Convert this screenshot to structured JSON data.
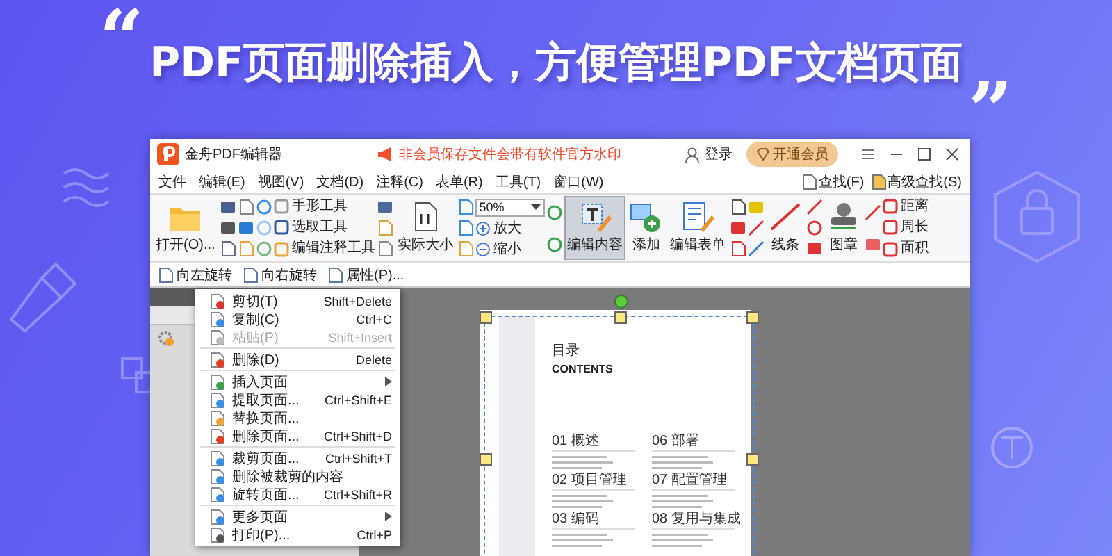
{
  "headline": {
    "open_quote": "“",
    "text": "PDF页面删除插入，方便管理PDF文档页面",
    "close_quote": "”"
  },
  "app": {
    "title": "金舟PDF编辑器",
    "notice": "非会员保存文件会带有软件官方水印",
    "login": "登录",
    "vip_button": "开通会员",
    "menu": [
      "文件",
      "编辑(E)",
      "视图(V)",
      "文档(D)",
      "注释(C)",
      "表单(R)",
      "工具(T)",
      "窗口(W)"
    ],
    "search_links": [
      "查找(F)",
      "高级查找(S)"
    ],
    "ribbon": [
      {
        "kind": "large",
        "label": "打开(O)...",
        "selected": false
      },
      {
        "kind": "icons"
      },
      {
        "kind": "icons"
      },
      {
        "kind": "icons"
      },
      {
        "kind": "tools",
        "labels": [
          "手形工具",
          "选取工具",
          "编辑注释工具"
        ]
      },
      {
        "kind": "icons"
      },
      {
        "kind": "large",
        "label": "实际大小",
        "selected": false
      },
      {
        "kind": "icons"
      },
      {
        "kind": "zoom",
        "value": "50%",
        "labels": [
          "放大",
          "缩小"
        ]
      },
      {
        "kind": "icons"
      },
      {
        "kind": "large",
        "label": "编辑内容",
        "selected": true
      },
      {
        "kind": "large",
        "label": "添加",
        "selected": false
      },
      {
        "kind": "large",
        "label": "编辑表单",
        "selected": false
      },
      {
        "kind": "icons"
      },
      {
        "kind": "icons"
      },
      {
        "kind": "large",
        "label": "线条",
        "selected": false
      },
      {
        "kind": "icons"
      },
      {
        "kind": "large",
        "label": "图章",
        "selected": false
      },
      {
        "kind": "icons"
      },
      {
        "kind": "tools",
        "labels": [
          "距离",
          "周长",
          "面积"
        ]
      }
    ],
    "sub_toolbar": [
      "向左旋转",
      "向右旋转",
      "属性(P)..."
    ],
    "context_menu": [
      {
        "kind": "item",
        "label": "剪切(T)",
        "shortcut": "Shift+Delete",
        "disabled": false,
        "submenu": false
      },
      {
        "kind": "item",
        "label": "复制(C)",
        "shortcut": "Ctrl+C",
        "disabled": false,
        "submenu": false
      },
      {
        "kind": "item",
        "label": "粘贴(P)",
        "shortcut": "Shift+Insert",
        "disabled": true,
        "submenu": false
      },
      {
        "kind": "separator"
      },
      {
        "kind": "item",
        "label": "删除(D)",
        "shortcut": "Delete",
        "disabled": false,
        "submenu": false
      },
      {
        "kind": "separator"
      },
      {
        "kind": "item",
        "label": "插入页面",
        "disabled": false,
        "submenu": true
      },
      {
        "kind": "item",
        "label": "提取页面...",
        "shortcut": "Ctrl+Shift+E",
        "disabled": false,
        "submenu": false
      },
      {
        "kind": "item",
        "label": "替换页面...",
        "disabled": false,
        "submenu": false
      },
      {
        "kind": "item",
        "label": "删除页面...",
        "shortcut": "Ctrl+Shift+D",
        "disabled": false,
        "submenu": false
      },
      {
        "kind": "separator"
      },
      {
        "kind": "item",
        "label": "裁剪页面...",
        "shortcut": "Ctrl+Shift+T",
        "disabled": false,
        "submenu": false
      },
      {
        "kind": "item",
        "label": "删除被裁剪的内容",
        "disabled": false,
        "submenu": false
      },
      {
        "kind": "item",
        "label": "旋转页面...",
        "shortcut": "Ctrl+Shift+R",
        "disabled": false,
        "submenu": false
      },
      {
        "kind": "separator"
      },
      {
        "kind": "item",
        "label": "更多页面",
        "disabled": false,
        "submenu": true
      },
      {
        "kind": "item",
        "label": "打印(P)...",
        "shortcut": "Ctrl+P",
        "disabled": false,
        "submenu": false
      }
    ],
    "document": {
      "title": "目录",
      "subtitle": "CONTENTS",
      "columns": [
        [
          {
            "heading": "01 概述"
          },
          {
            "heading": "02 项目管理"
          },
          {
            "heading": "03 编码"
          }
        ],
        [
          {
            "heading": "06 部署"
          },
          {
            "heading": "07 配置管理"
          },
          {
            "heading": "08 复用与集成"
          }
        ]
      ]
    }
  }
}
